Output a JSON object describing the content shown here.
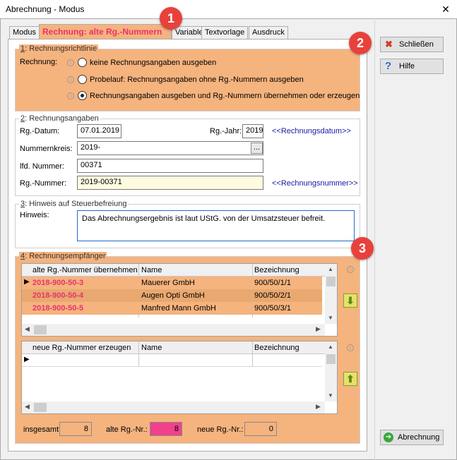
{
  "window": {
    "title": "Abrechnung - Modus",
    "close_glyph": "✕"
  },
  "tabs": [
    {
      "label": "Modus"
    },
    {
      "label": "Rechnung: alte Rg.-Nummern",
      "active": true
    },
    {
      "label": "Variable"
    },
    {
      "label": "Textvorlage"
    },
    {
      "label": "Ausdruck"
    }
  ],
  "badges": [
    "1",
    "2",
    "3"
  ],
  "section1": {
    "num": "1",
    "title": ": Rechnungsrichtlinie",
    "label": "Rechnung:",
    "options": [
      "keine Rechnungsangaben ausgeben",
      "Probelauf: Rechnungsangaben ohne Rg.-Nummern ausgeben",
      "Rechnungsangaben ausgeben und Rg.-Nummern übernehmen oder erzeugen"
    ],
    "selected": 2
  },
  "section2": {
    "num": "2",
    "title": ": Rechnungsangaben",
    "datum_label": "Rg.-Datum:",
    "datum": "07.01.2019",
    "jahr_label": "Rg.-Jahr:",
    "jahr": "2019",
    "datum_link": "<<Rechnungsdatum>>",
    "kreis_label": "Nummernkreis:",
    "kreis": "2019-",
    "browse": "...",
    "lfd_label": "lfd. Nummer:",
    "lfd": "00371",
    "rg_label": "Rg.-Nummer:",
    "rg": "2019-00371",
    "rg_link": "<<Rechnungsnummer>>"
  },
  "section3": {
    "num": "3",
    "title": ": Hinweis auf Steuerbefreiung",
    "label": "Hinweis:",
    "text": "Das Abrechnungsergebnis ist laut UStG. von der Umsatzsteuer befreit."
  },
  "section4": {
    "num": "4",
    "title": ": Rechnungsempfänger",
    "grid1": {
      "headers": [
        "alte Rg.-Nummer übernehmen",
        "Name",
        "Bezeichnung"
      ],
      "rows": [
        [
          "2018-900-50-3",
          "Mauerer GmbH",
          "900/50/1/1"
        ],
        [
          "2018-900-50-4",
          "Augen Opti GmbH",
          "900/50/2/1"
        ],
        [
          "2018-900-50-5",
          "Manfred Mann GmbH",
          "900/50/3/1"
        ]
      ]
    },
    "grid2": {
      "headers": [
        "neue Rg.-Nummer erzeugen",
        "Name",
        "Bezeichnung"
      ]
    },
    "total_label": "insgesamt:",
    "total": "8",
    "old_label": "alte Rg.-Nr.:",
    "old": "8",
    "new_label": "neue Rg.-Nr.:",
    "new": "0"
  },
  "buttons": {
    "close": "Schließen",
    "help": "Hilfe",
    "billing": "Abrechnung"
  },
  "colors": {
    "accent": "#f5b37e",
    "pink": "#e8326c",
    "badge": "#e8413c",
    "old_count": "#f0418a"
  }
}
